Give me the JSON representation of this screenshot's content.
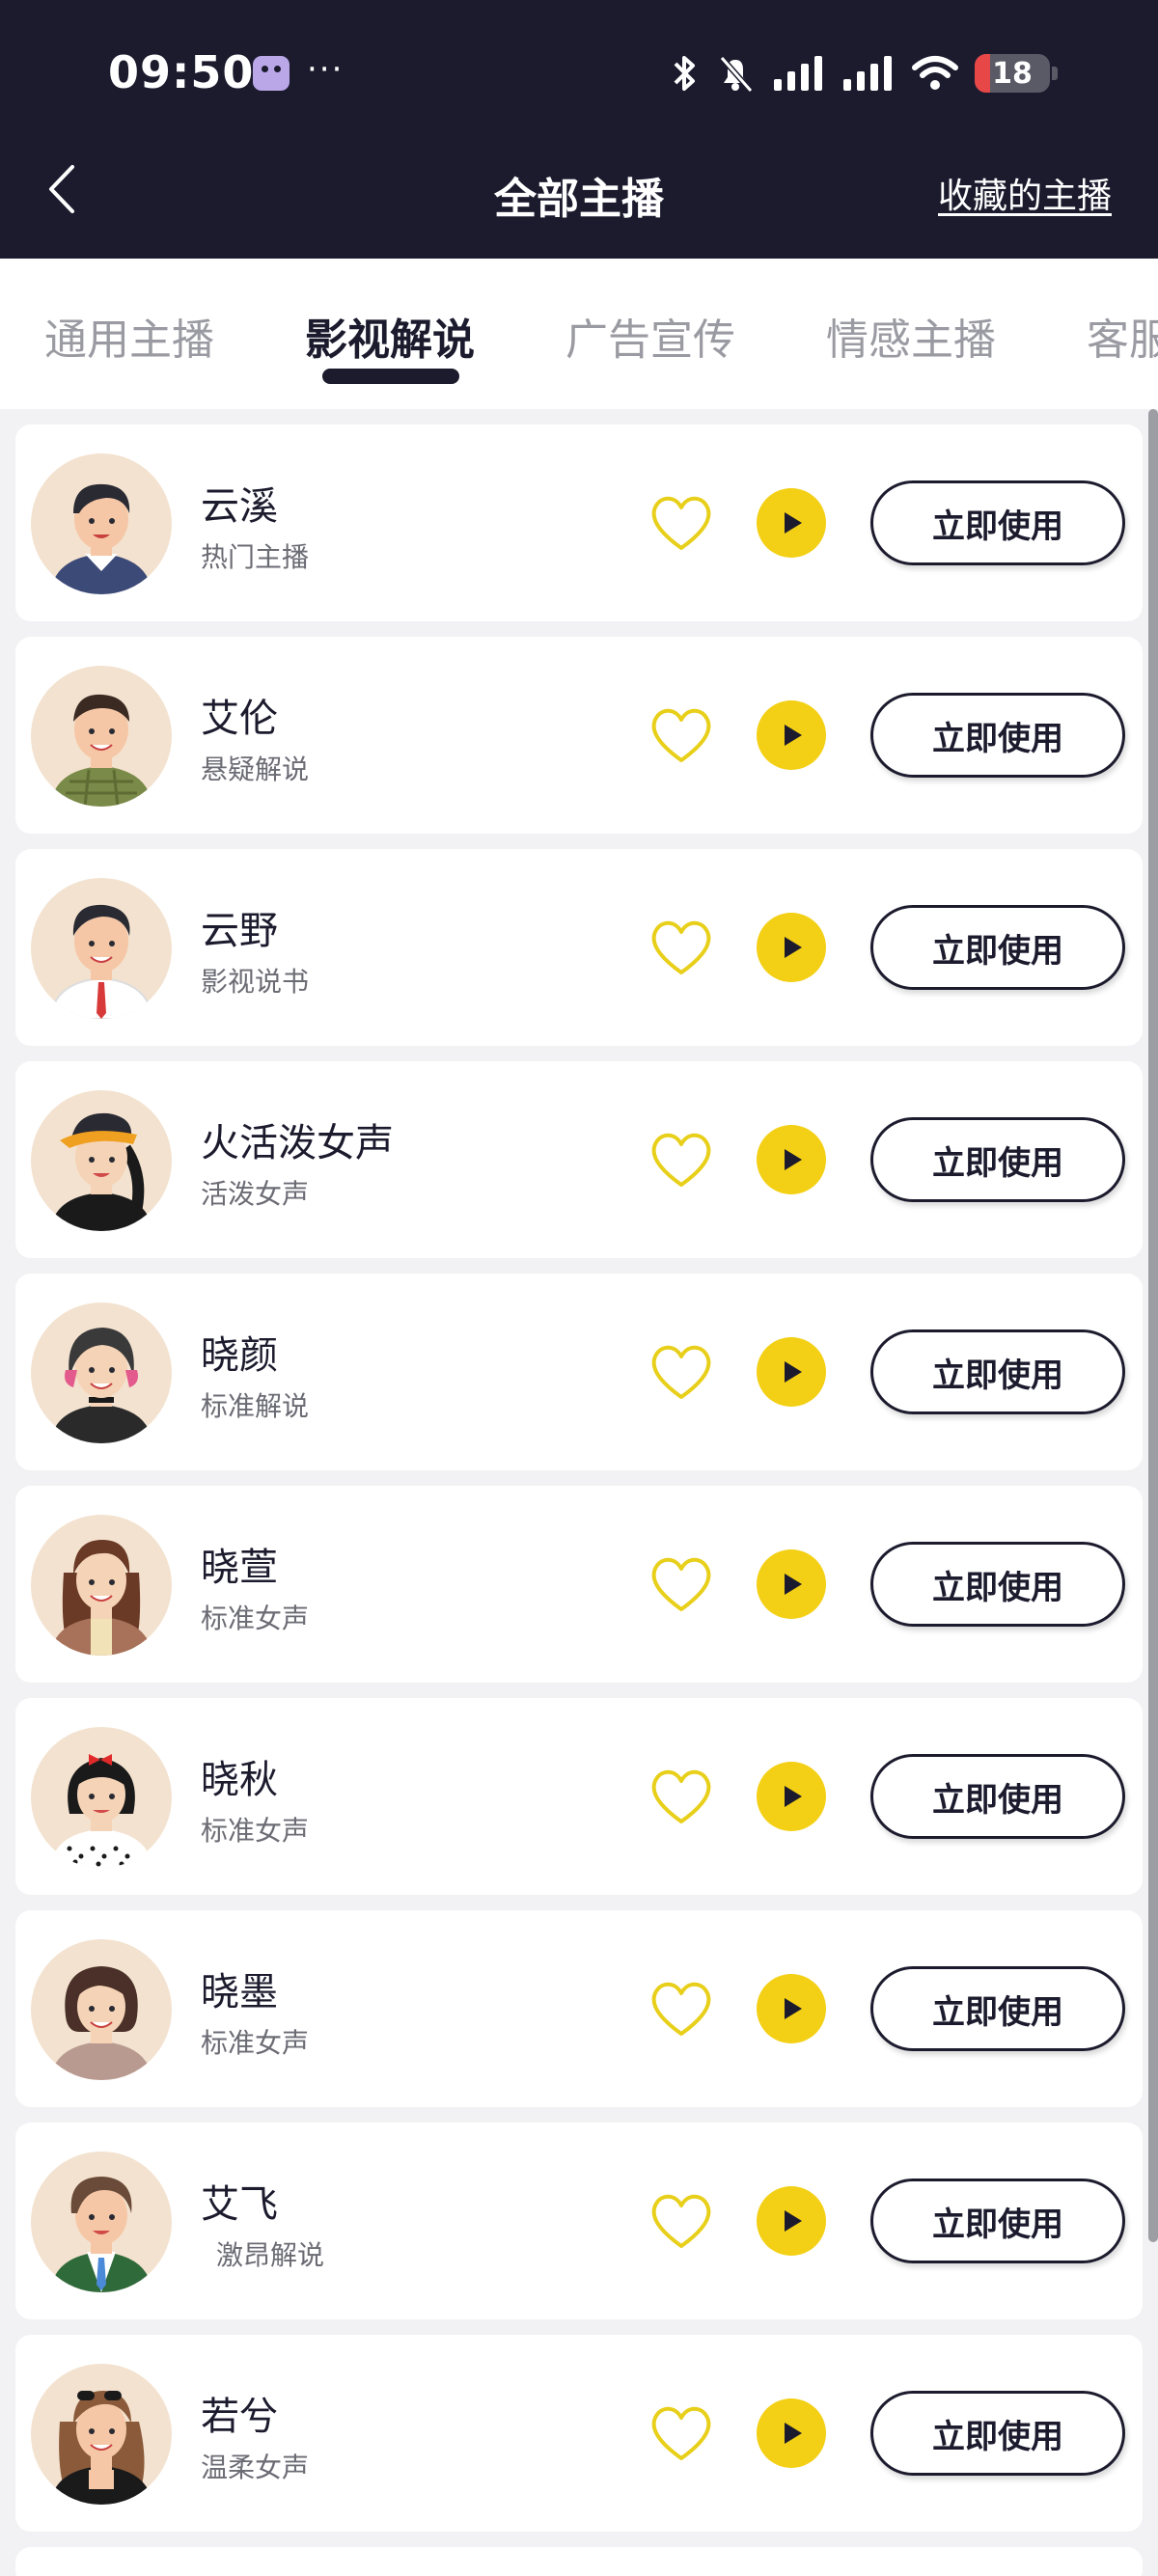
{
  "status_bar": {
    "time": "09:50",
    "dots": "···",
    "battery": "18",
    "icons": [
      "bluetooth-icon",
      "mute-bell-icon",
      "signal-icon",
      "signal-icon",
      "wifi-icon",
      "battery-icon"
    ]
  },
  "header": {
    "title": "全部主播",
    "favorites_link": "收藏的主播"
  },
  "tabs": [
    {
      "label": "通用主播",
      "active": false
    },
    {
      "label": "影视解说",
      "active": true
    },
    {
      "label": "广告宣传",
      "active": false
    },
    {
      "label": "情感主播",
      "active": false
    },
    {
      "label": "客服",
      "active": false
    }
  ],
  "anchors": [
    {
      "name": "云溪",
      "desc": "热门主播",
      "action": "立即使用"
    },
    {
      "name": "艾伦",
      "desc": "悬疑解说",
      "action": "立即使用"
    },
    {
      "name": "云野",
      "desc": "影视说书",
      "action": "立即使用"
    },
    {
      "name": "火活泼女声",
      "desc": "活泼女声",
      "action": "立即使用"
    },
    {
      "name": "晓颜",
      "desc": "标准解说",
      "action": "立即使用"
    },
    {
      "name": "晓萱",
      "desc": "标准女声",
      "action": "立即使用"
    },
    {
      "name": "晓秋",
      "desc": "标准女声",
      "action": "立即使用"
    },
    {
      "name": "晓墨",
      "desc": "标准女声",
      "action": "立即使用"
    },
    {
      "name": "艾飞",
      "desc": "激昂解说",
      "action": "立即使用"
    },
    {
      "name": "若兮",
      "desc": "温柔女声",
      "action": "立即使用"
    }
  ],
  "colors": {
    "header_bg": "#1c1b2e",
    "accent_yellow": "#f3d015",
    "heart_outline": "#e8cf1a",
    "page_bg": "#f2f2f4",
    "battery_low": "#e84747"
  }
}
